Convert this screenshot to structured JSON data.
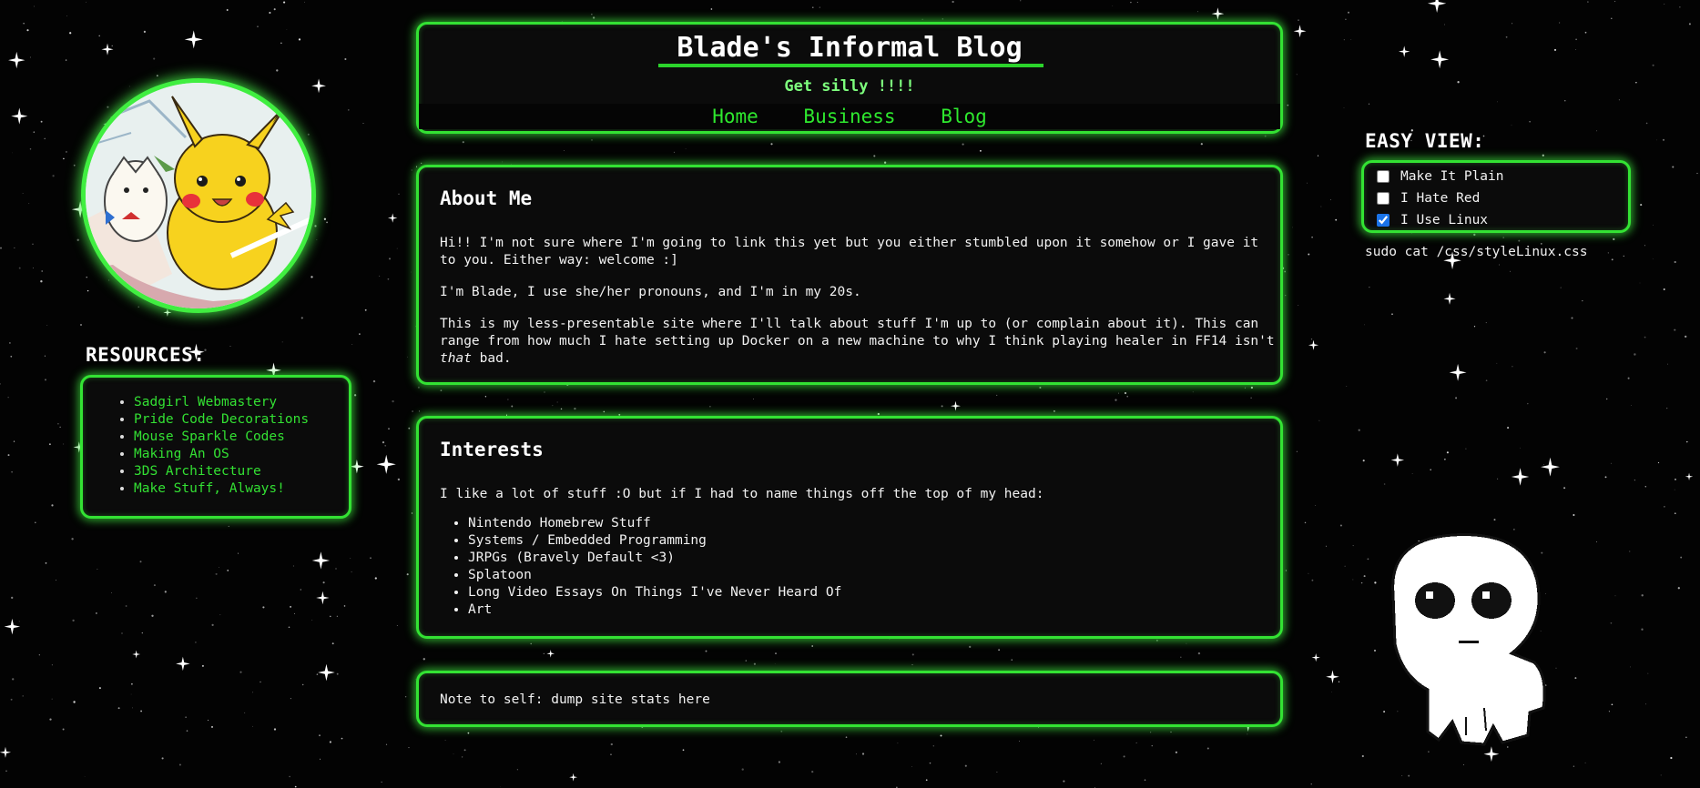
{
  "header": {
    "title": "Blade's Informal Blog",
    "tagline": "Get silly !!!!",
    "nav": [
      "Home",
      "Business",
      "Blog"
    ]
  },
  "resources": {
    "heading": "RESOURCES:",
    "links": [
      "Sadgirl Webmastery",
      "Pride Code Decorations",
      "Mouse Sparkle Codes",
      "Making An OS",
      "3DS Architecture",
      "Make Stuff, Always!"
    ]
  },
  "about": {
    "title": "About Me",
    "p1": "Hi!! I'm not sure where I'm going to link this yet but you either stumbled upon it somehow or I gave it to you. Either way: welcome :]",
    "p2": "I'm Blade, I use she/her pronouns, and I'm in my 20s.",
    "p3_before": "This is my less-presentable site where I'll talk about stuff I'm up to (or complain about it). This can range from how much I hate setting up Docker on a new machine to why I think playing healer in FF14 isn't ",
    "p3_emph": "that",
    "p3_after": " bad."
  },
  "interests": {
    "title": "Interests",
    "intro": "I like a lot of stuff :O but if I had to name things off the top of my head:",
    "items": [
      "Nintendo Homebrew Stuff",
      "Systems / Embedded Programming",
      "JRPGs (Bravely Default <3)",
      "Splatoon",
      "Long Video Essays On Things I've Never Heard Of",
      "Art"
    ]
  },
  "stats": {
    "text": "Note to self: dump site stats here"
  },
  "easy_view": {
    "heading": "EASY VIEW:",
    "options": [
      {
        "label": "Make It Plain",
        "checked": false
      },
      {
        "label": "I Hate Red",
        "checked": false
      },
      {
        "label": "I Use Linux",
        "checked": true
      }
    ],
    "css_path": "sudo cat /css/styleLinux.css"
  },
  "images": {
    "avatar": "pikachu-togepi-avatar",
    "mascot": "white-alien-creature"
  },
  "colors": {
    "accent": "#33e233",
    "link": "#33e033",
    "tagline": "#7dff7d",
    "background": "#030303",
    "panel": "#0b0b0b"
  }
}
